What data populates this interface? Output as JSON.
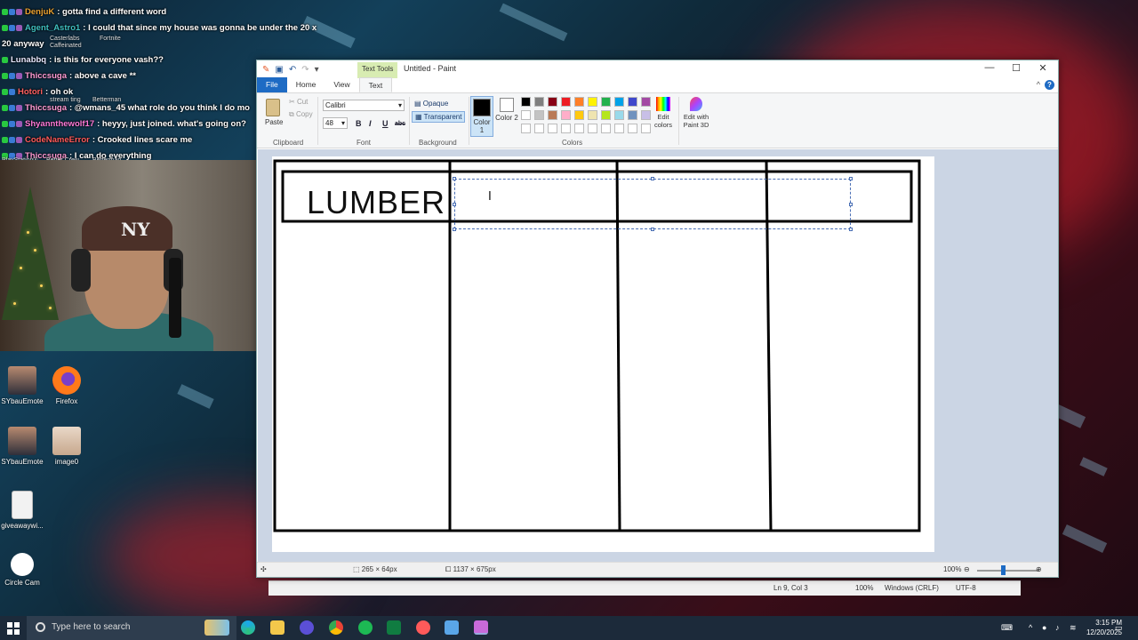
{
  "chat": {
    "messages": [
      {
        "user": "DenjuK",
        "text": ": gotta find a different word",
        "color": "#e8a030"
      },
      {
        "user": "Agent_Astro1",
        "text": ": I could that since my house was gonna be under the 20 x",
        "color": "#3fc0c0"
      },
      {
        "user": "",
        "text": "20 anyway",
        "color": "#ffffff"
      },
      {
        "user": "Lunabbq",
        "text": ": is this for everyone vash??",
        "color": "#e8e8ff"
      },
      {
        "user": "Thiccsuga",
        "text": ": above a cave **",
        "color": "#ff9bd5"
      },
      {
        "user": "Hotori",
        "text": ": oh ok",
        "color": "#ff6060"
      },
      {
        "user": "Thiccsuga",
        "text": ": @wmans_45 what role do you think I do mo",
        "color": "#ff9bd5"
      },
      {
        "user": "Shyannthewolf17",
        "text": ": heyyy, just joined. what's going on?",
        "color": "#ff7ad9"
      },
      {
        "user": "CodeNameError",
        "text": ": Crooked lines scare me",
        "color": "#ff5a5a"
      },
      {
        "user": "Thiccsuga",
        "text": ": I can do everything",
        "color": "#ff9bd5"
      }
    ],
    "overlay_labels": [
      "Casterlabs Caffeinated",
      "Fortnite",
      "stream ting",
      "Betterman",
      "PlayStation®",
      "Better Crew",
      "Betterman"
    ]
  },
  "desktop_icons": [
    {
      "label": "SYbauEmote",
      "icon": "emote-icon"
    },
    {
      "label": "Firefox",
      "icon": "firefox-icon"
    },
    {
      "label": "SYbauEmote",
      "icon": "emote-icon"
    },
    {
      "label": "image0",
      "icon": "image-icon"
    },
    {
      "label": "giveawaywi...",
      "icon": "file-icon"
    },
    {
      "label": "Circle Cam",
      "icon": "camera-icon"
    }
  ],
  "paint": {
    "context_tab": "Text Tools",
    "window_title": "Untitled - Paint",
    "tabs": {
      "file": "File",
      "home": "Home",
      "view": "View",
      "text": "Text"
    },
    "clipboard": {
      "paste": "Paste",
      "cut": "Cut",
      "copy": "Copy",
      "group": "Clipboard"
    },
    "font": {
      "family": "Calibri",
      "size": "48",
      "bold": "B",
      "italic": "I",
      "underline": "U",
      "strike": "abc",
      "group": "Font"
    },
    "background": {
      "opaque": "Opaque",
      "transparent": "Transparent",
      "group": "Background"
    },
    "colors": {
      "color1_label": "Color 1",
      "color2_label": "Color 2",
      "color1": "#000000",
      "color2": "#ffffff",
      "edit_colors": "Edit colors",
      "edit_with_paint3d": "Edit with Paint 3D",
      "group": "Colors",
      "palette": [
        "#000000",
        "#7f7f7f",
        "#880015",
        "#ed1c24",
        "#ff7f27",
        "#fff200",
        "#22b14c",
        "#00a2e8",
        "#3f48cc",
        "#a349a4",
        "#ffffff",
        "#c3c3c3",
        "#b97a57",
        "#ffaec9",
        "#ffc90e",
        "#efe4b0",
        "#b5e61d",
        "#99d9ea",
        "#7092be",
        "#c8bfe7",
        "#ffffff",
        "#ffffff",
        "#ffffff",
        "#ffffff",
        "#ffffff",
        "#ffffff",
        "#ffffff",
        "#ffffff",
        "#ffffff",
        "#ffffff"
      ]
    },
    "canvas_text": "LUMBER",
    "status": {
      "selection_size": "265 × 64px",
      "image_size": "1137 × 675px",
      "zoom": "100%"
    }
  },
  "notepad_status": {
    "position": "Ln 9, Col 3",
    "zoom": "100%",
    "line_ending": "Windows (CRLF)",
    "encoding": "UTF-8"
  },
  "taskbar": {
    "search_placeholder": "Type here to search",
    "time": "3:15 PM",
    "date": "12/20/2025"
  }
}
